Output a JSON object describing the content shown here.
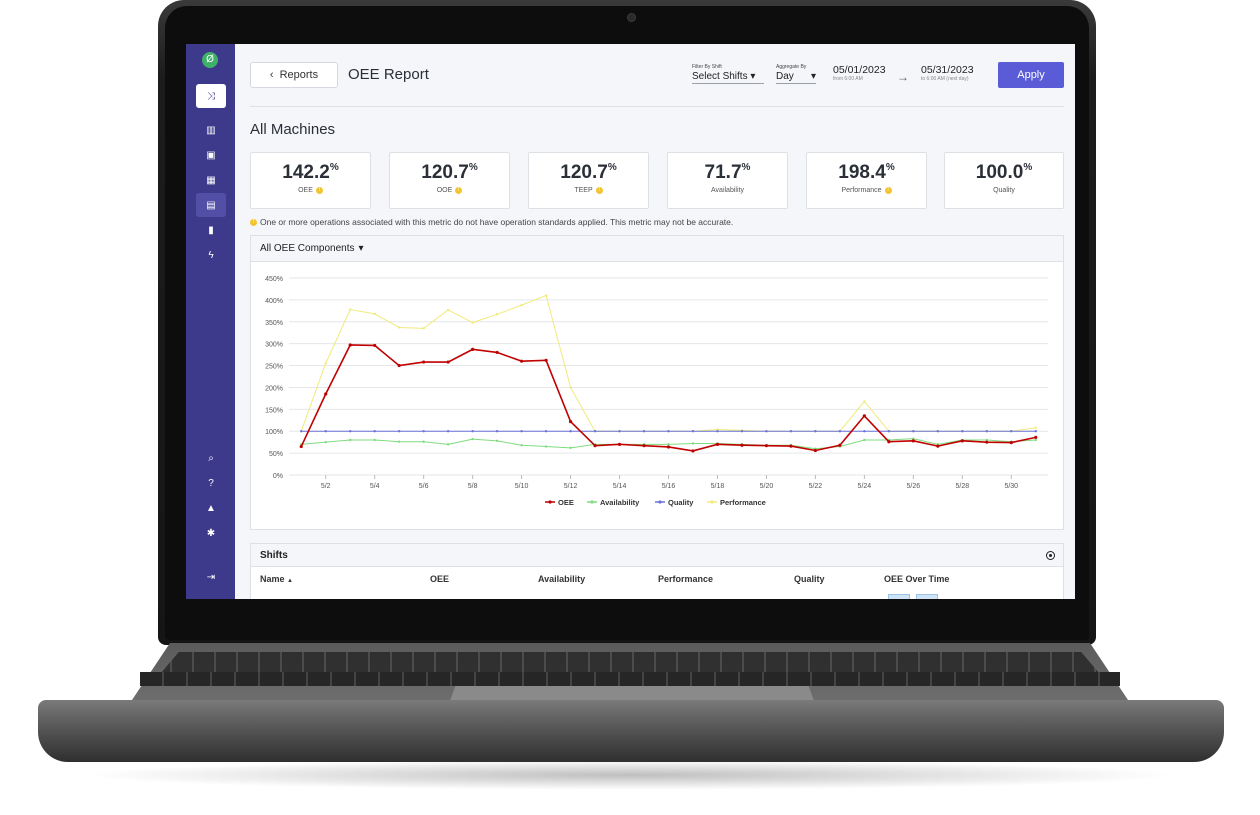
{
  "sidebar": {
    "logo": "Ø",
    "items": [
      {
        "icon": "shuffle-icon",
        "glyph": "⤨"
      },
      {
        "icon": "factory-icon",
        "glyph": "▥"
      },
      {
        "icon": "id-card-icon",
        "glyph": "▣"
      },
      {
        "icon": "calendar-icon",
        "glyph": "▦"
      },
      {
        "icon": "report-icon",
        "glyph": "▤"
      },
      {
        "icon": "bar-chart-icon",
        "glyph": "▮"
      },
      {
        "icon": "lightning-icon",
        "glyph": "ϟ"
      },
      {
        "icon": "search-icon",
        "glyph": "⌕"
      },
      {
        "icon": "help-icon",
        "glyph": "?"
      },
      {
        "icon": "lock-icon",
        "glyph": "▲"
      },
      {
        "icon": "gear-icon",
        "glyph": "✱"
      },
      {
        "icon": "logout-icon",
        "glyph": "⇥"
      }
    ]
  },
  "header": {
    "back_label": "Reports",
    "back_glyph": "‹",
    "title": "OEE Report",
    "shift_filter": {
      "label": "Filter By Shift",
      "value": "Select Shifts"
    },
    "aggregate": {
      "label": "Aggregate By",
      "value": "Day"
    },
    "start": {
      "date": "05/01/2023",
      "sub": "from 6:00 AM"
    },
    "end": {
      "date": "05/31/2023",
      "sub": "to 6:00 AM (next day)"
    },
    "arrow": "→",
    "apply_label": "Apply",
    "apply_color": "#5a5bd6"
  },
  "section_title": "All Machines",
  "metrics": [
    {
      "value": "142.2",
      "unit": "%",
      "label": "OEE",
      "warn": true
    },
    {
      "value": "120.7",
      "unit": "%",
      "label": "OOE",
      "warn": true
    },
    {
      "value": "120.7",
      "unit": "%",
      "label": "TEEP",
      "warn": true
    },
    {
      "value": "71.7",
      "unit": "%",
      "label": "Availability",
      "warn": false
    },
    {
      "value": "198.4",
      "unit": "%",
      "label": "Performance",
      "warn": true
    },
    {
      "value": "100.0",
      "unit": "%",
      "label": "Quality",
      "warn": false
    }
  ],
  "note": "One or more operations associated with this metric do not have operation standards applied. This metric may not be accurate.",
  "chart_header": "All OEE Components",
  "chart_data": {
    "type": "line",
    "x": [
      1,
      2,
      3,
      4,
      5,
      6,
      7,
      8,
      9,
      10,
      11,
      12,
      13,
      14,
      15,
      16,
      17,
      18,
      19,
      20,
      21,
      22,
      23,
      24,
      25,
      26,
      27,
      28,
      29,
      30,
      31
    ],
    "xticks": [
      "5/2",
      "5/4",
      "5/6",
      "5/8",
      "5/10",
      "5/12",
      "5/14",
      "5/16",
      "5/18",
      "5/20",
      "5/22",
      "5/24",
      "5/26",
      "5/28",
      "5/30"
    ],
    "xtick_days": [
      2,
      4,
      6,
      8,
      10,
      12,
      14,
      16,
      18,
      20,
      22,
      24,
      26,
      28,
      30
    ],
    "yticks": [
      "0%",
      "50%",
      "100%",
      "150%",
      "200%",
      "250%",
      "300%",
      "350%",
      "400%",
      "450%"
    ],
    "ylim": [
      0,
      450
    ],
    "series": [
      {
        "name": "OEE",
        "color": "#c00000",
        "values": [
          65,
          185,
          297,
          296,
          250,
          258,
          258,
          287,
          280,
          260,
          262,
          122,
          67,
          70,
          67,
          64,
          55,
          70,
          68,
          67,
          66,
          56,
          68,
          135,
          76,
          78,
          66,
          78,
          75,
          74,
          86
        ]
      },
      {
        "name": "Availability",
        "color": "#7fdc7f",
        "values": [
          70,
          75,
          80,
          80,
          76,
          76,
          70,
          82,
          78,
          68,
          65,
          62,
          70,
          70,
          70,
          70,
          72,
          72,
          70,
          68,
          68,
          60,
          65,
          80,
          80,
          83,
          70,
          80,
          80,
          76,
          80
        ]
      },
      {
        "name": "Quality",
        "color": "#6a73d8",
        "values": [
          100,
          100,
          100,
          100,
          100,
          100,
          100,
          100,
          100,
          100,
          100,
          100,
          100,
          100,
          100,
          100,
          100,
          100,
          100,
          100,
          100,
          100,
          100,
          100,
          100,
          100,
          100,
          100,
          100,
          100,
          100
        ]
      },
      {
        "name": "Performance",
        "color": "#f1ea7a",
        "values": [
          100,
          255,
          378,
          368,
          337,
          335,
          377,
          348,
          367,
          388,
          410,
          200,
          100,
          100,
          100,
          100,
          100,
          104,
          102,
          100,
          100,
          100,
          100,
          168,
          100,
          100,
          100,
          100,
          100,
          100,
          108
        ]
      }
    ],
    "legend_position": "bottom",
    "grid": true
  },
  "shifts": {
    "title": "Shifts",
    "columns": [
      "Name",
      "OEE",
      "Availability",
      "Performance",
      "Quality",
      "OEE Over Time"
    ],
    "sort_glyph": "▲"
  }
}
